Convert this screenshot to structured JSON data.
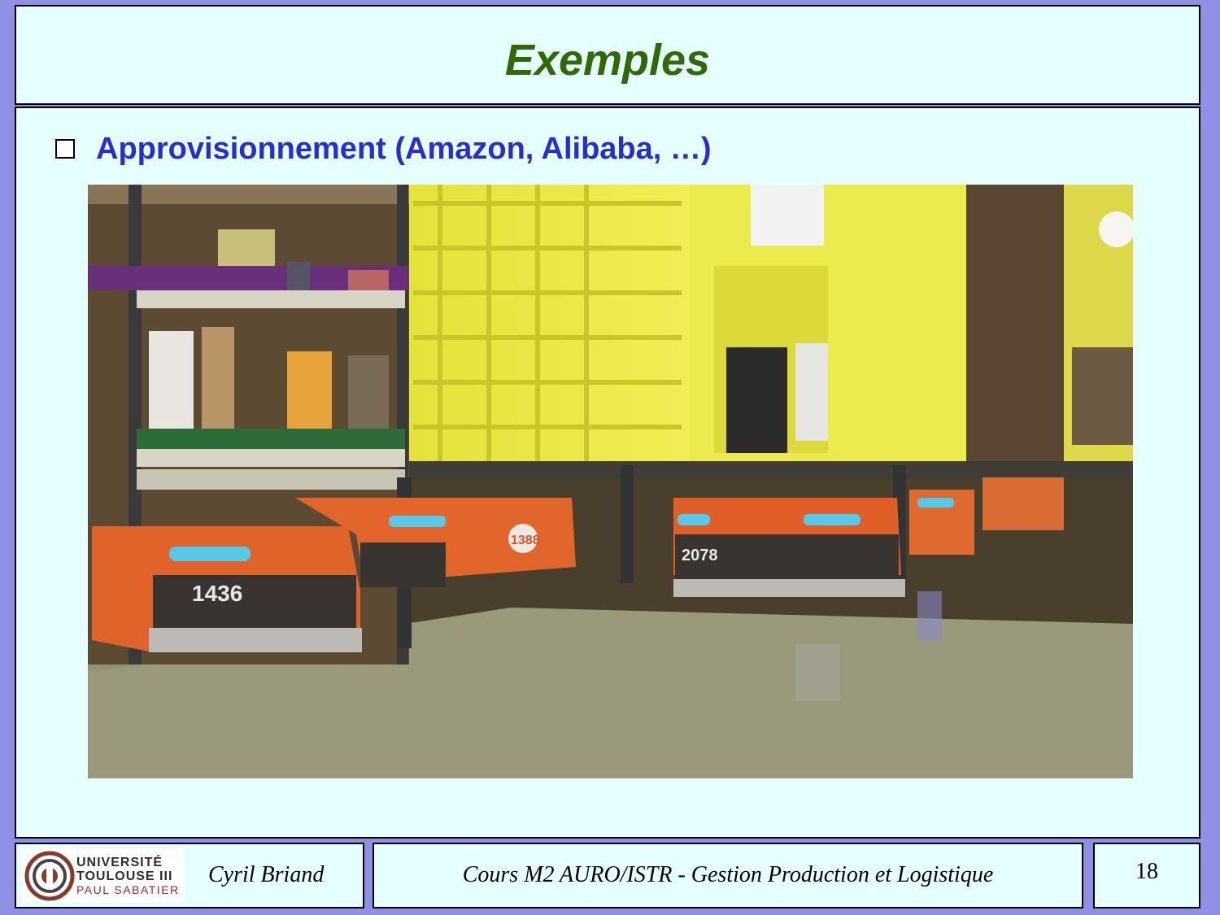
{
  "slide": {
    "title": "Exemples",
    "bullet": "Approvisionnement (Amazon, Alibaba, …)",
    "image": {
      "robot_labels": [
        "1436",
        "1388",
        "2078"
      ]
    }
  },
  "footer": {
    "logo": {
      "line1": "UNIVERSITÉ",
      "line2": "TOULOUSE III",
      "line3": "PAUL SABATIER"
    },
    "author": "Cyril Briand",
    "course": "Cours M2 AURO/ISTR - Gestion Production et Logistique",
    "page_number": "18"
  },
  "colors": {
    "background": "#8f8fe6",
    "panel": "#e6ffff",
    "title": "#2f6a06",
    "bullet_text": "#2b2bd1"
  }
}
